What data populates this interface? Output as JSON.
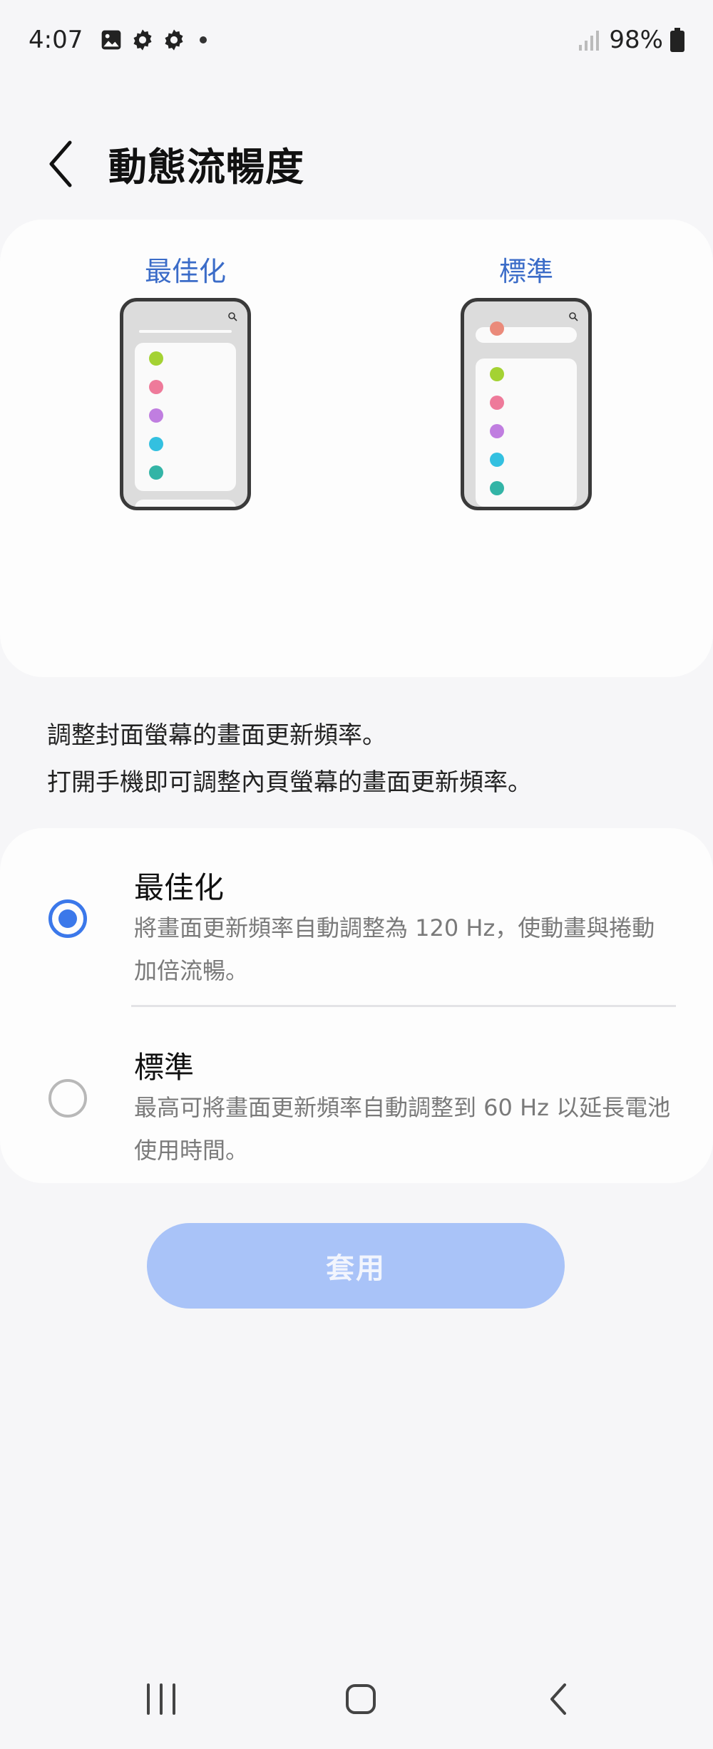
{
  "status_bar": {
    "time": "4:07",
    "battery": "98%",
    "icons": [
      "image-icon",
      "gear-icon",
      "gear-icon",
      "dot-icon",
      "signal-icon",
      "battery-icon"
    ]
  },
  "header": {
    "title": "動態流暢度",
    "back_icon": "chevron-left-icon"
  },
  "preview": {
    "optimized_label": "最佳化",
    "standard_label": "標準",
    "dot_colors": [
      "#a4d233",
      "#ee7a9a",
      "#c07ee0",
      "#33c0e0",
      "#33b4a6",
      "#7b86e6",
      "#7fa8ee",
      "#6fc36e",
      "#ea6e66"
    ]
  },
  "description": {
    "line1": "調整封面螢幕的畫面更新頻率。",
    "line2": "打開手機即可調整內頁螢幕的畫面更新頻率。"
  },
  "options": [
    {
      "title": "最佳化",
      "subtitle": "將畫面更新頻率自動調整為 120 Hz，使動畫與捲動加倍流暢。",
      "selected": true
    },
    {
      "title": "標準",
      "subtitle": "最高可將畫面更新頻率自動調整到 60 Hz 以延長電池使用時間。",
      "selected": false
    }
  ],
  "apply_button": {
    "label": "套用"
  },
  "nav_bar": {
    "icons": [
      "recent-apps-icon",
      "home-icon",
      "back-icon"
    ]
  },
  "colors": {
    "accent": "#3b78ea",
    "link_blue": "#3b6cc8",
    "apply_disabled": "#a9c3f8"
  }
}
